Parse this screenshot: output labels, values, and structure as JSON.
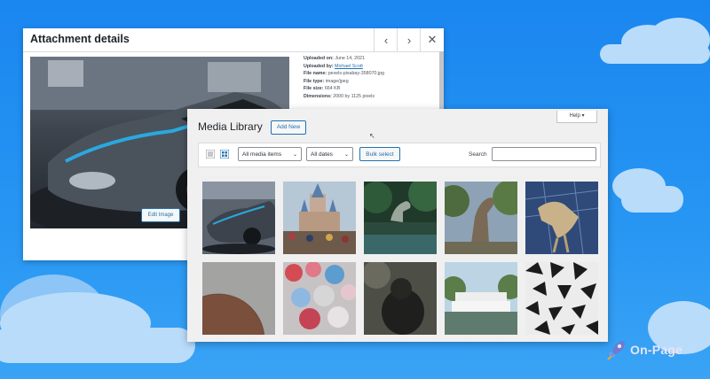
{
  "attachment": {
    "title": "Attachment details",
    "prev_icon": "chevron-left",
    "next_icon": "chevron-right",
    "close_icon": "close",
    "edit_label": "Edit Image",
    "meta": {
      "uploaded_on_label": "Uploaded on:",
      "uploaded_on": "June 14, 2021",
      "uploaded_by_label": "Uploaded by:",
      "uploaded_by": "Michael Scott",
      "file_name_label": "File name:",
      "file_name": "pexels-pixabay-358070.jpg",
      "file_type_label": "File type:",
      "file_type": "image/jpeg",
      "file_size_label": "File size:",
      "file_size": "664 KB",
      "dimensions_label": "Dimensions:",
      "dimensions": "2000 by 1125 pixels"
    }
  },
  "media_library": {
    "title": "Media Library",
    "add_new_label": "Add New",
    "help_label": "Help",
    "filter_type": "All media items",
    "filter_date": "All dates",
    "bulk_label": "Bulk select",
    "search_label": "Search",
    "search_value": ""
  },
  "thumbnails": [
    {
      "subject": "gray sports car",
      "color": "#3f4650"
    },
    {
      "subject": "castle parade crowd",
      "color": "#8d7f70"
    },
    {
      "subject": "dinosaur by water",
      "color": "#2f5a3f"
    },
    {
      "subject": "dinosaur sculpture garden",
      "color": "#6b7b58"
    },
    {
      "subject": "t-rex skeleton",
      "color": "#3b4f73"
    },
    {
      "subject": "geodesic sphere",
      "color": "#9a9a98"
    },
    {
      "subject": "balloons market",
      "color": "#b78a8c"
    },
    {
      "subject": "gorilla",
      "color": "#3a3a36"
    },
    {
      "subject": "riverboat",
      "color": "#6f8da0"
    },
    {
      "subject": "geodesic pattern",
      "color": "#d8d8d8"
    }
  ],
  "brand": {
    "name": "On-Page",
    "icon": "rocket-icon",
    "text_color": "#e8e5f5"
  }
}
